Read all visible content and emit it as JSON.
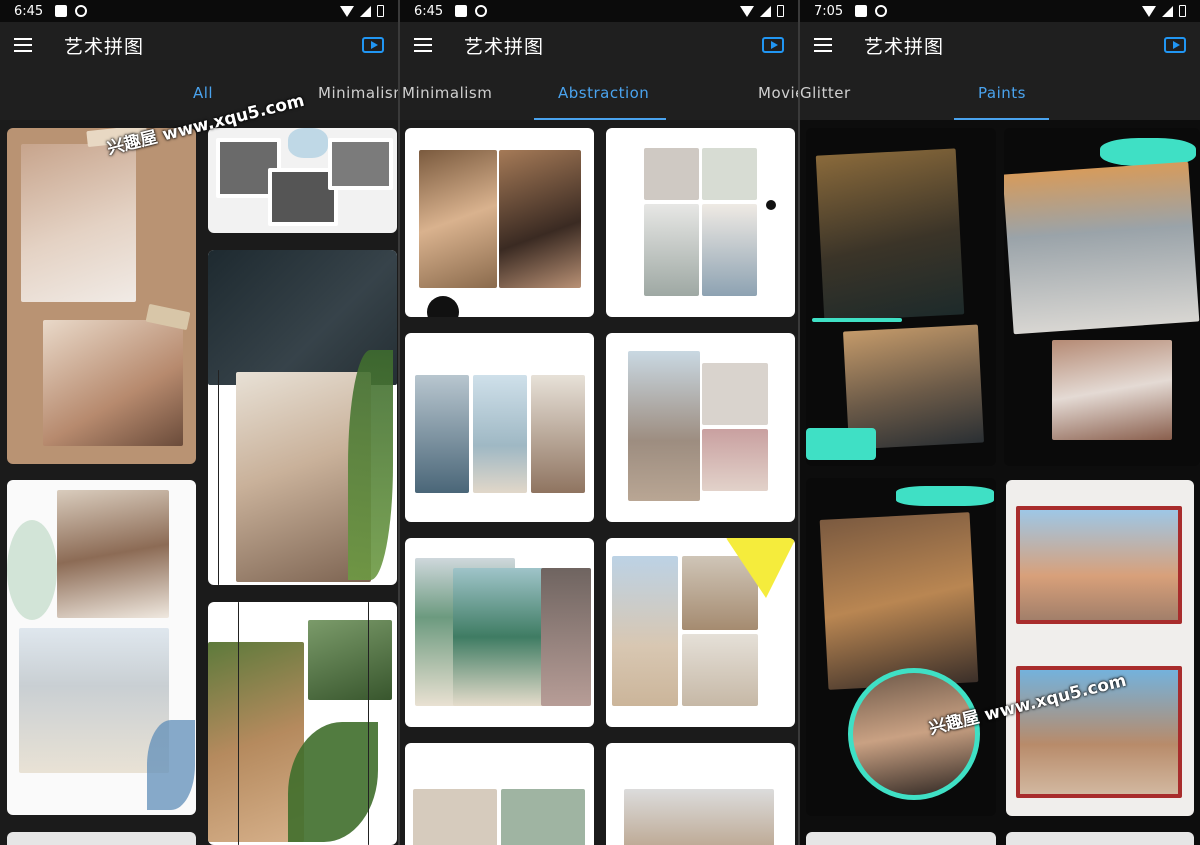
{
  "screens": [
    {
      "status": {
        "time": "6:45"
      },
      "toolbar": {
        "title": "艺术拼图"
      },
      "tabs": [
        "All",
        "Minimalism"
      ],
      "watermark": "兴趣屋 www.xqu5.com"
    },
    {
      "status": {
        "time": "6:45"
      },
      "toolbar": {
        "title": "艺术拼图"
      },
      "tabs": [
        "Minimalism",
        "Abstraction",
        "Movie"
      ]
    },
    {
      "status": {
        "time": "7:05"
      },
      "toolbar": {
        "title": "艺术拼图"
      },
      "tabs": [
        "Glitter",
        "Paints"
      ],
      "watermark": "兴趣屋 www.xqu5.com"
    }
  ],
  "icons": [
    "menu-icon",
    "video-play-icon",
    "wifi-icon",
    "signal-icon",
    "battery-icon",
    "notification-a-icon",
    "settings-gear-icon"
  ],
  "colors": {
    "accent": "#4aa3ee",
    "toolbar": "#1f1f1f",
    "paint_teal": "#3fe0c5",
    "paint_red": "#a82c2c"
  }
}
